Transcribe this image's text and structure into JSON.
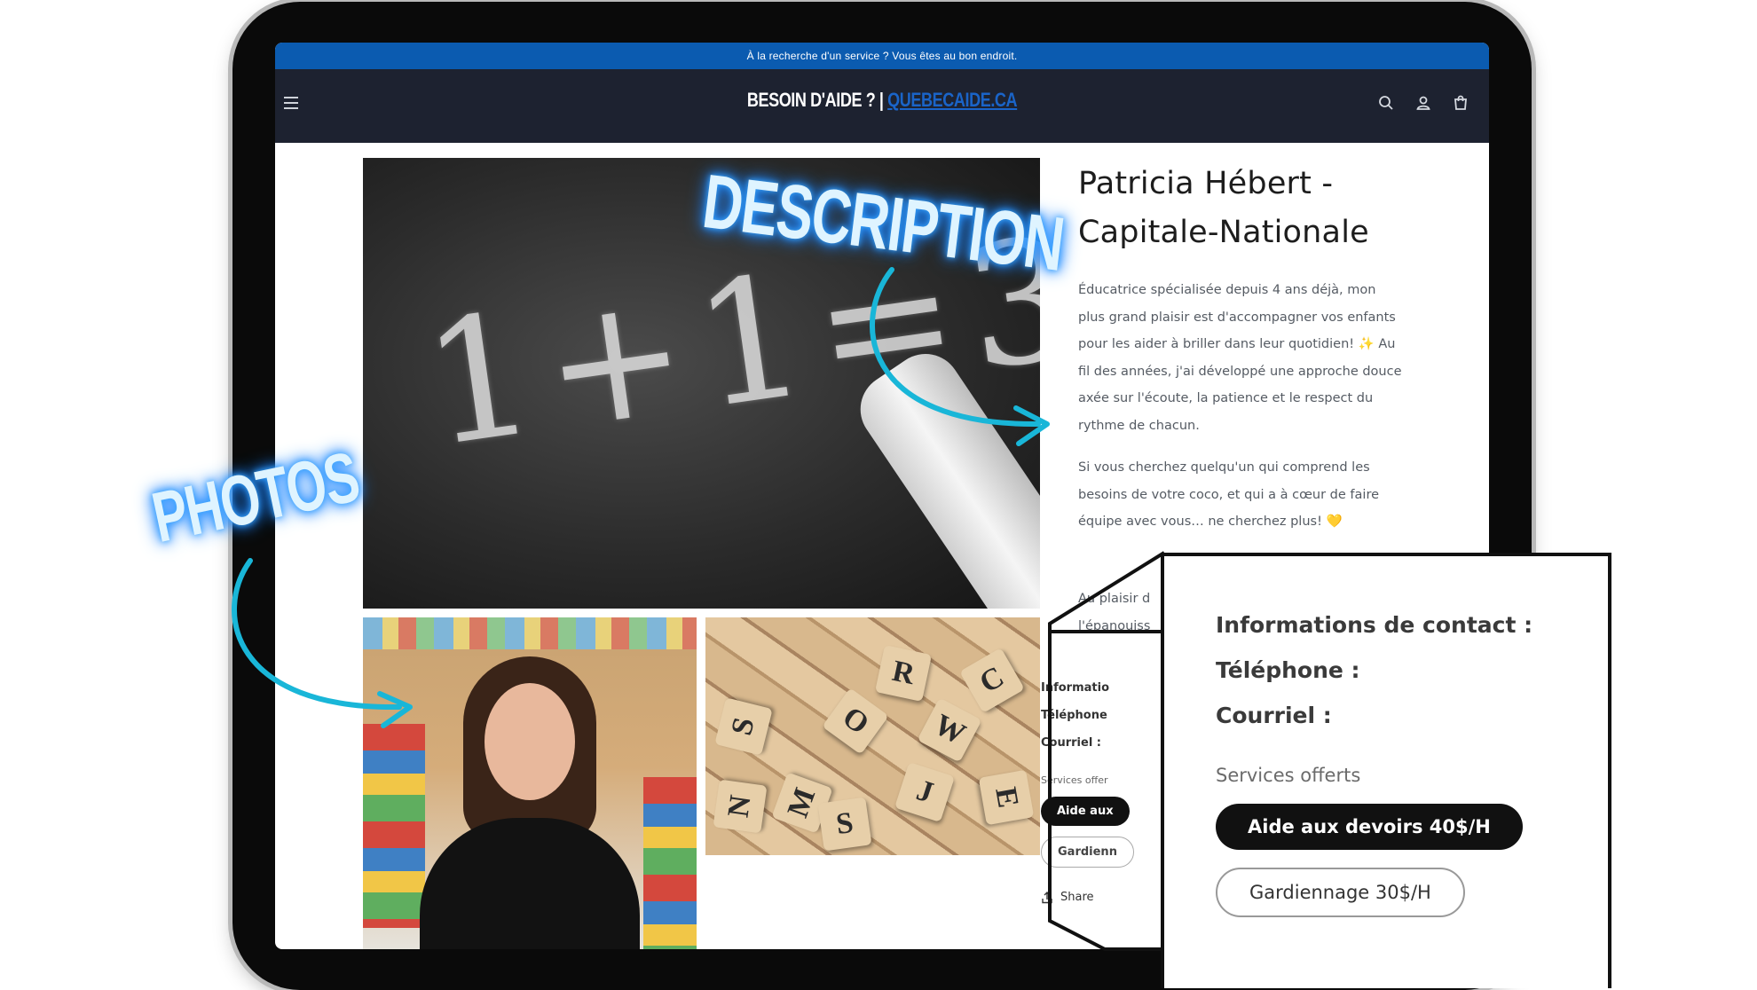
{
  "announcement": {
    "text": "À la recherche d'un service ? Vous êtes au bon endroit."
  },
  "header": {
    "logo_part1": "BESOIN D'AIDE ? | ",
    "logo_part2": "QUEBECAIDE.CA"
  },
  "product": {
    "title": "Patricia Hébert - Capitale-Nationale",
    "description": [
      "Éducatrice spécialisée depuis 4 ans déjà, mon plus grand plaisir est d'accompagner vos enfants pour les aider à briller dans leur quotidien! ✨ Au fil des années, j'ai développé une approche douce axée sur l'écoute, la patience et le respect du rythme de chacun.",
      "Si vous cherchez quelqu'un qui comprend les besoins de votre coco, et qui a à cœur de faire équipe avec vous… ne cherchez plus! 💛"
    ],
    "desc_cut_1": "Au plaisir d",
    "desc_cut_2": "l'épanouiss"
  },
  "media": {
    "main_image_text": "1+1=3",
    "tile_letters": [
      "R",
      "C",
      "W",
      "S",
      "M",
      "J",
      "E",
      "N",
      "S",
      "O"
    ]
  },
  "contact_small": {
    "info": "Informatio",
    "phone": "Téléphone",
    "email": "Courriel :",
    "services": "Services offer",
    "service1": "Aide aux",
    "service2": "Gardienn",
    "share": "Share"
  },
  "contact_zoom": {
    "info": "Informations de contact :",
    "phone": "Téléphone :",
    "email": "Courriel :",
    "services": "Services offerts",
    "service1": "Aide aux devoirs 40$/H",
    "service2": "Gardiennage 30$/H"
  },
  "annotations": {
    "description": "DESCRIPTION",
    "photos": "PHOTOS"
  },
  "colors": {
    "announcement_bg": "#0b5bb0",
    "header_bg": "#1d2230",
    "logo_accent": "#1a64c8",
    "glow": "#1c84ff",
    "arrow": "#19b6d8"
  },
  "icons": [
    "menu-icon",
    "search-icon",
    "account-icon",
    "cart-icon",
    "share-icon"
  ]
}
